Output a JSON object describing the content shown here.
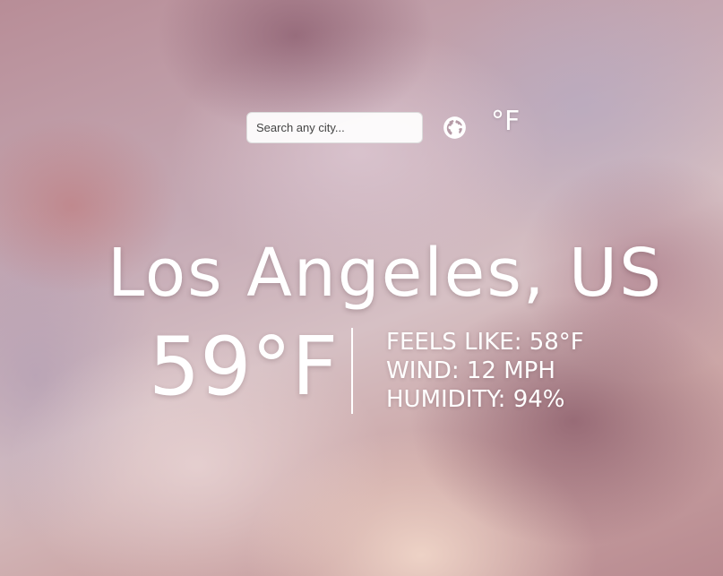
{
  "search": {
    "placeholder": "Search any city...",
    "value": ""
  },
  "toolbar": {
    "globe_icon": "globe-icon",
    "unit_label": "°F"
  },
  "weather": {
    "city": "Los Angeles, US",
    "temperature": "59°F",
    "feels_like": "FEELS LIKE: 58°F",
    "wind": "WIND: 12 MPH",
    "humidity": "HUMIDITY: 94%"
  },
  "colors": {
    "text": "#ffffff",
    "search_bg": "#ffffff"
  }
}
